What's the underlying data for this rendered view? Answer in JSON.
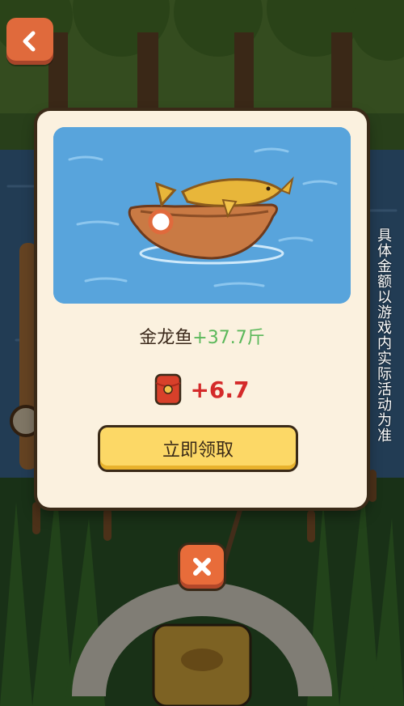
{
  "header": {
    "back_icon": "chevron-left-icon"
  },
  "side_note": "具体金额以游戏内实际活动为准",
  "modal": {
    "fish_name": "金龙鱼",
    "fish_weight": "+37.7斤",
    "reward_icon": "red-packet-icon",
    "reward_value": "+6.7",
    "claim_label": "立即领取"
  },
  "close_icon": "close-icon",
  "colors": {
    "accent_orange": "#e06a3c",
    "claim_yellow": "#fcd866",
    "reward_red": "#d42a2a",
    "weight_green": "#5bb85a"
  }
}
